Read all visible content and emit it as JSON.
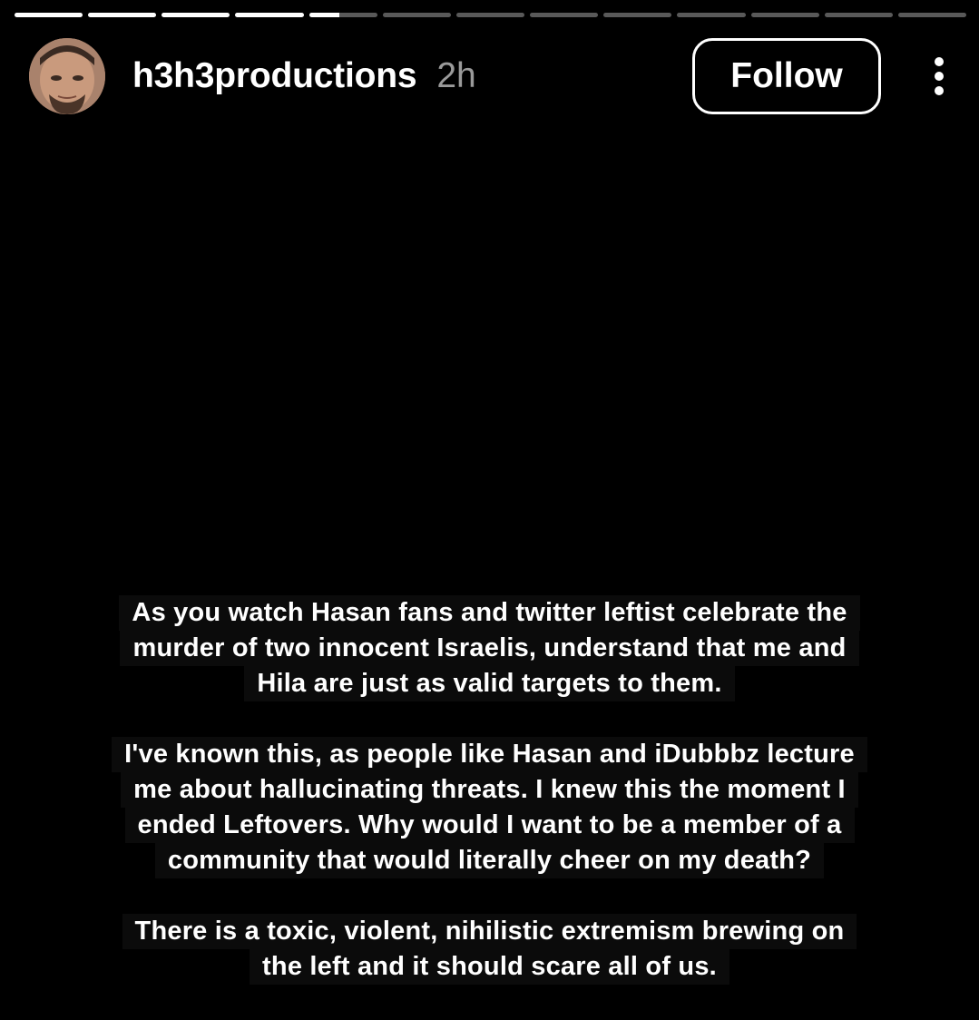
{
  "progress": {
    "segments_total": 13,
    "segments_complete": 4,
    "current_segment_progress": 0.45
  },
  "header": {
    "username": "h3h3productions",
    "time_ago": "2h",
    "follow_label": "Follow",
    "more_icon": "more-vertical-icon",
    "avatar_icon": "profile-photo"
  },
  "story": {
    "paragraphs": [
      {
        "lines": [
          "As you watch Hasan fans and twitter leftist celebrate the",
          "murder of two innocent Israelis, understand that me and",
          "Hila are just as valid targets to them."
        ]
      },
      {
        "lines": [
          "I've known this, as people like Hasan and iDubbbz lecture",
          "me about hallucinating threats. I knew this the moment I",
          "ended Leftovers. Why would I want to be a member of a",
          "community that would literally cheer on my death?"
        ]
      },
      {
        "lines": [
          "There is a toxic, violent, nihilistic extremism brewing on",
          "the left and it should scare all of us."
        ]
      }
    ]
  },
  "colors": {
    "background": "#000000",
    "text": "#ffffff",
    "text_box": "#0b0b0b",
    "time_gray": "#9a9a9a"
  }
}
